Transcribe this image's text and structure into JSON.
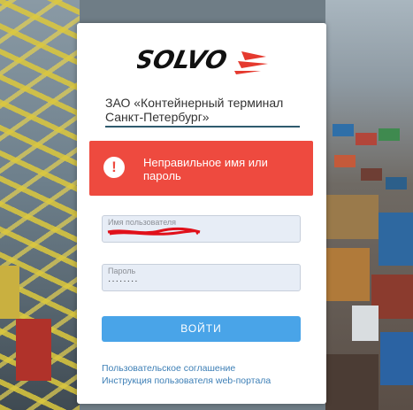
{
  "logo": {
    "text": "SOLVO"
  },
  "company_name": "ЗАО «Контейнерный терминал Санкт-Петербург»",
  "alert": {
    "icon": "exclamation-icon",
    "message": "Неправильное имя или пароль"
  },
  "username": {
    "label": "Имя пользователя",
    "value": ""
  },
  "password": {
    "label": "Пароль",
    "value": "········"
  },
  "login_button": {
    "label": "ВОЙТИ"
  },
  "links": [
    {
      "label": "Пользовательское соглашение"
    },
    {
      "label": "Инструкция пользователя web-портала"
    }
  ],
  "colors": {
    "alert": "#ee4a3f",
    "button": "#49a4e8",
    "logo_red": "#e53a2f",
    "link": "#3d7fb6"
  }
}
